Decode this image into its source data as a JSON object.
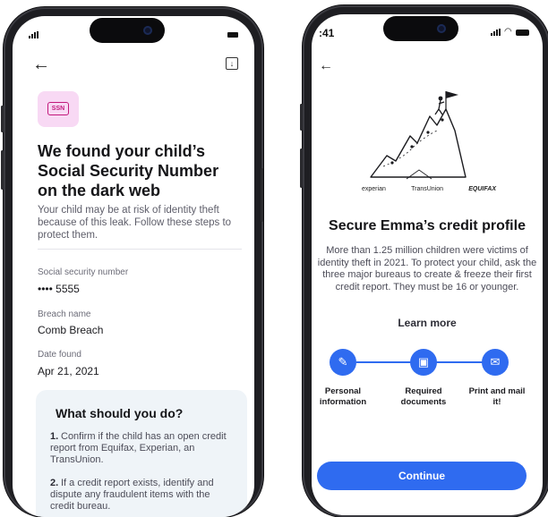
{
  "left_screen": {
    "badge_text": "SSN",
    "title": "We found your child’s Social Security Number on the dark web",
    "description": "Your child may be at risk of identity theft because of this leak. Follow these steps to protect them.",
    "fields": [
      {
        "label": "Social security number",
        "value": "•••• 5555"
      },
      {
        "label": "Breach name",
        "value": "Comb Breach"
      },
      {
        "label": "Date found",
        "value": "Apr 21, 2021"
      }
    ],
    "card": {
      "title": "What should you do?",
      "steps": [
        {
          "num": "1.",
          "text": "Confirm if the child has an open credit report from Equifax, Experian, an TransUnion."
        },
        {
          "num": "2.",
          "text": "If a credit report exists, identify and dispute any fraudulent items with the credit bureau."
        }
      ]
    }
  },
  "right_screen": {
    "status_time": ":41",
    "bureaus": [
      "experian",
      "TransUnion",
      "EQUIFAX"
    ],
    "title": "Secure Emma’s credit profile",
    "description": "More than 1.25 million children were victims of identity theft in 2021. To protect your child, ask the three major bureaus to create & freeze their first credit report. They must be 16 or younger.",
    "learn_more": "Learn more",
    "steps": [
      {
        "label": "Personal information",
        "icon": "pen-icon"
      },
      {
        "label": "Required documents",
        "icon": "document-icon"
      },
      {
        "label": "Print and mail it!",
        "icon": "mail-icon"
      }
    ],
    "continue_label": "Continue"
  },
  "colors": {
    "accent": "#2f6bf0",
    "badge_bg": "#f8d9f4",
    "badge_fg": "#c2187c",
    "card_bg": "#eff4f8"
  }
}
